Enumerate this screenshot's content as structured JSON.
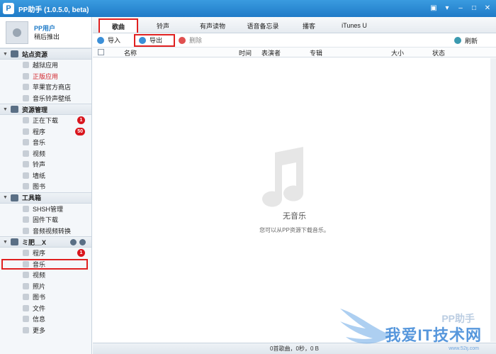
{
  "window": {
    "title": "PP助手 (1.0.5.0, beta)",
    "logo_glyph": "P"
  },
  "user": {
    "name": "PP用户",
    "action": "稍后推出"
  },
  "sidebar": {
    "groups": [
      {
        "title": "站点资源",
        "items": [
          {
            "label": "越狱应用"
          },
          {
            "label": "正版应用"
          },
          {
            "label": "苹果官方商店"
          },
          {
            "label": "音乐铃声壁纸"
          }
        ]
      },
      {
        "title": "资源管理",
        "items": [
          {
            "label": "正在下载",
            "badge": "1"
          },
          {
            "label": "程序",
            "badge": "50"
          },
          {
            "label": "音乐"
          },
          {
            "label": "视频"
          },
          {
            "label": "铃声"
          },
          {
            "label": "墙纸"
          },
          {
            "label": "图书"
          }
        ]
      },
      {
        "title": "工具箱",
        "items": [
          {
            "label": "SHSH管理"
          },
          {
            "label": "固件下载"
          },
          {
            "label": "音频视频转换"
          }
        ]
      },
      {
        "title": "ミ肥__X",
        "items": [
          {
            "label": "程序",
            "badge": "1"
          },
          {
            "label": "音乐"
          },
          {
            "label": "视频"
          },
          {
            "label": "照片"
          },
          {
            "label": "图书"
          },
          {
            "label": "文件"
          },
          {
            "label": "信息"
          },
          {
            "label": "更多"
          }
        ]
      }
    ]
  },
  "tabs": [
    "歌曲",
    "铃声",
    "有声读物",
    "语音备忘录",
    "播客",
    "iTunes U"
  ],
  "toolbar": {
    "import": "导入",
    "export": "导出",
    "delete": "删除",
    "refresh": "刷新"
  },
  "columns": [
    "名称",
    "时间",
    "表演者",
    "专辑",
    "大小",
    "状态"
  ],
  "empty": {
    "title": "无音乐",
    "subtitle": "您可以从PP资源下载音乐。"
  },
  "status": "0首歌曲，0秒，0 B",
  "watermark": {
    "brand": "PP助手",
    "text": "我爱IT技术网",
    "sub": "www.52ij.com"
  },
  "colors": {
    "accent": "#1f7bc8",
    "highlight": "#e02020",
    "badge": "#d9161e"
  }
}
